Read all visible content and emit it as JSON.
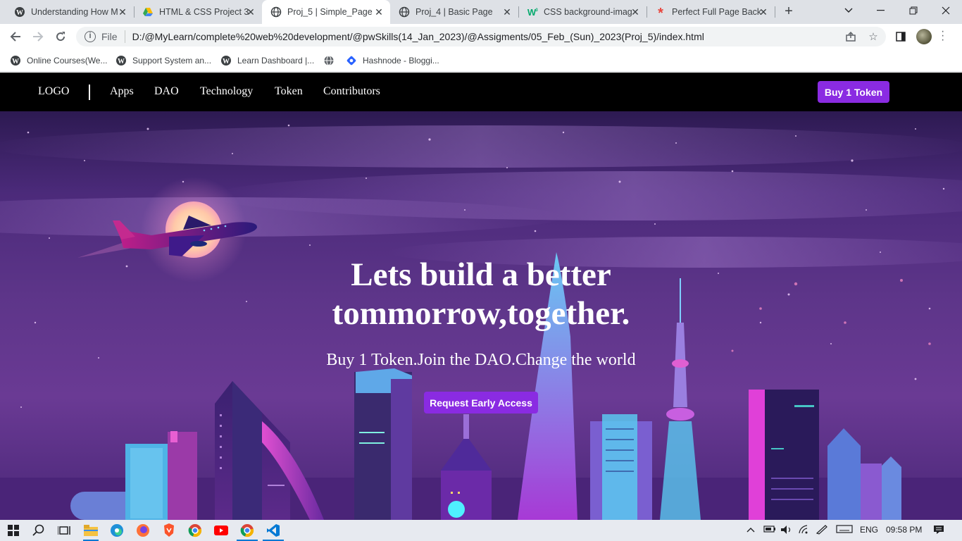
{
  "browser": {
    "tabs": [
      {
        "title": "Understanding How M",
        "icon": "wordpress-icon",
        "active": false
      },
      {
        "title": "HTML & CSS Project 3",
        "icon": "google-drive-icon",
        "active": false
      },
      {
        "title": "Proj_5 | Simple_Page",
        "icon": "globe-icon",
        "active": true
      },
      {
        "title": "Proj_4 | Basic Page",
        "icon": "globe-icon",
        "active": false
      },
      {
        "title": "CSS background-imag",
        "icon": "w3schools-icon",
        "active": false
      },
      {
        "title": "Perfect Full Page Back",
        "icon": "css-tricks-icon",
        "active": false
      }
    ],
    "address": {
      "scheme": "File",
      "url": "D:/@MyLearn/complete%20web%20development/@pwSkills(14_Jan_2023)/@Assigments/05_Feb_(Sun)_2023(Proj_5)/index.html"
    },
    "bookmarks": [
      {
        "label": "Online Courses(We...",
        "icon": "wordpress-icon"
      },
      {
        "label": "Support System an...",
        "icon": "wordpress-icon"
      },
      {
        "label": "Learn Dashboard |...",
        "icon": "wordpress-icon"
      },
      {
        "label": "",
        "icon": "globe-icon"
      },
      {
        "label": "Hashnode - Bloggi...",
        "icon": "hashnode-icon"
      }
    ]
  },
  "site": {
    "logo": "LOGO",
    "nav": [
      "Apps",
      "DAO",
      "Technology",
      "Token",
      "Contributors"
    ],
    "buy_button": "Buy 1 Token",
    "hero": {
      "title": "Lets build a better tommorrow,together.",
      "subtitle": "Buy 1 Token.Join the DAO.Change the world",
      "cta": "Request Early Access"
    },
    "accent": "#8a2be2"
  },
  "taskbar": {
    "language": "ENG",
    "time": "09:58 PM"
  }
}
